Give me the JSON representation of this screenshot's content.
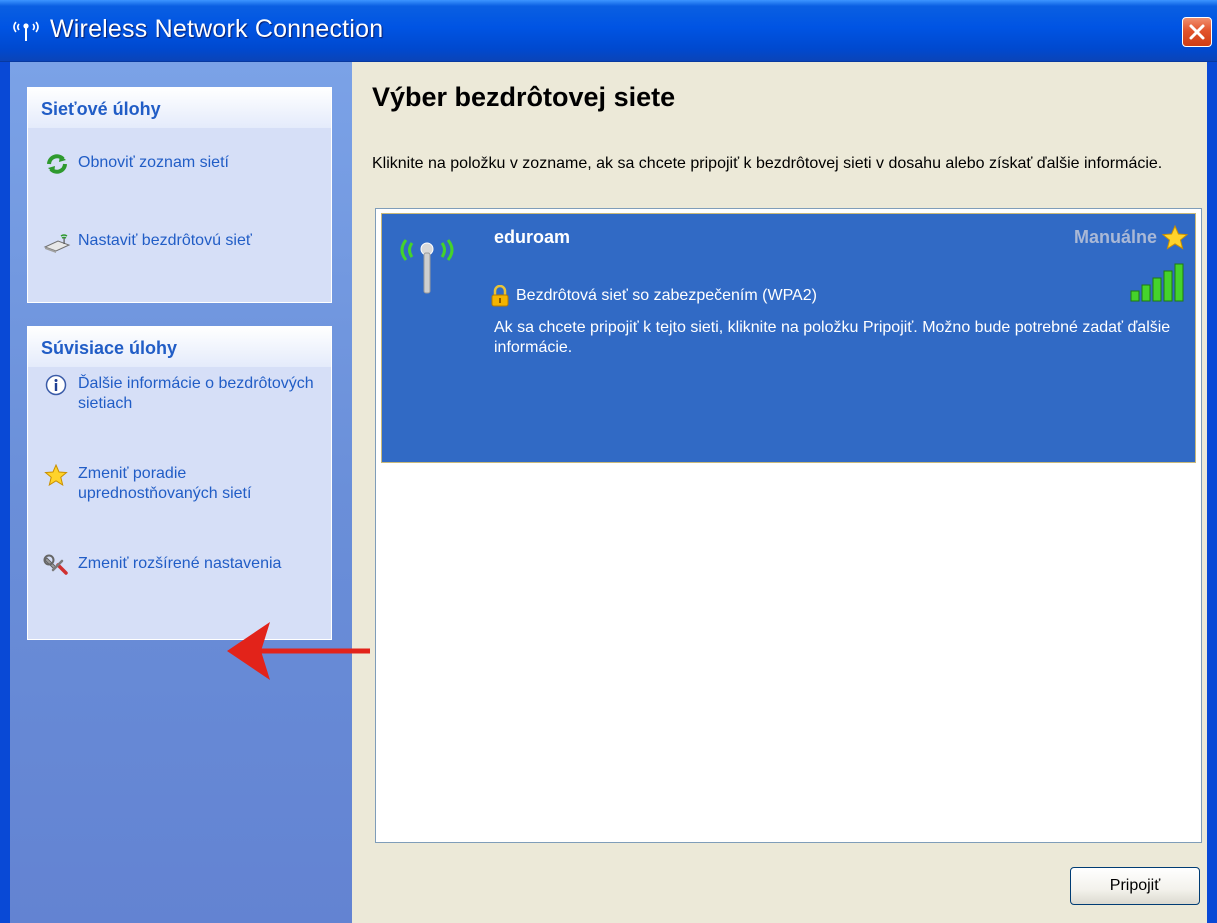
{
  "window": {
    "title": "Wireless Network Connection",
    "close_icon": "close-icon"
  },
  "sidebar": {
    "network_tasks": {
      "title": "Sieťové úlohy",
      "items": [
        {
          "label": "Obnoviť zoznam sietí",
          "icon": "refresh-icon"
        },
        {
          "label": "Nastaviť bezdrôtovú sieť",
          "icon": "wireless-setup-icon"
        }
      ]
    },
    "related_tasks": {
      "title": "Súvisiace úlohy",
      "items": [
        {
          "label": "Ďalšie informácie o bezdrôtových sietiach",
          "icon": "info-icon"
        },
        {
          "label": "Zmeniť poradie uprednostňovaných sietí",
          "icon": "star-icon"
        },
        {
          "label": "Zmeniť rozšírené nastavenia",
          "icon": "settings-icon"
        }
      ]
    }
  },
  "main": {
    "heading": "Výber bezdrôtovej siete",
    "intro": "Kliknite na položku v zozname, ak sa chcete pripojiť k bezdrôtovej sieti v dosahu alebo získať ďalšie informácie.",
    "networks": [
      {
        "ssid": "eduroam",
        "mode": "Manuálne",
        "security": "Bezdrôtová sieť so zabezpečením (WPA2)",
        "description": "Ak sa chcete pripojiť k tejto sieti, kliknite na položku Pripojiť. Možno bude potrebné zadať ďalšie informácie.",
        "signal_bars": 5,
        "selected": true
      }
    ],
    "connect_label": "Pripojiť"
  },
  "colors": {
    "titlebar": "#0054e3",
    "sidebar": "#6a8fd9",
    "task_link": "#215dc6",
    "selected_item": "#316ac5",
    "annotation_arrow": "#e2231a"
  }
}
